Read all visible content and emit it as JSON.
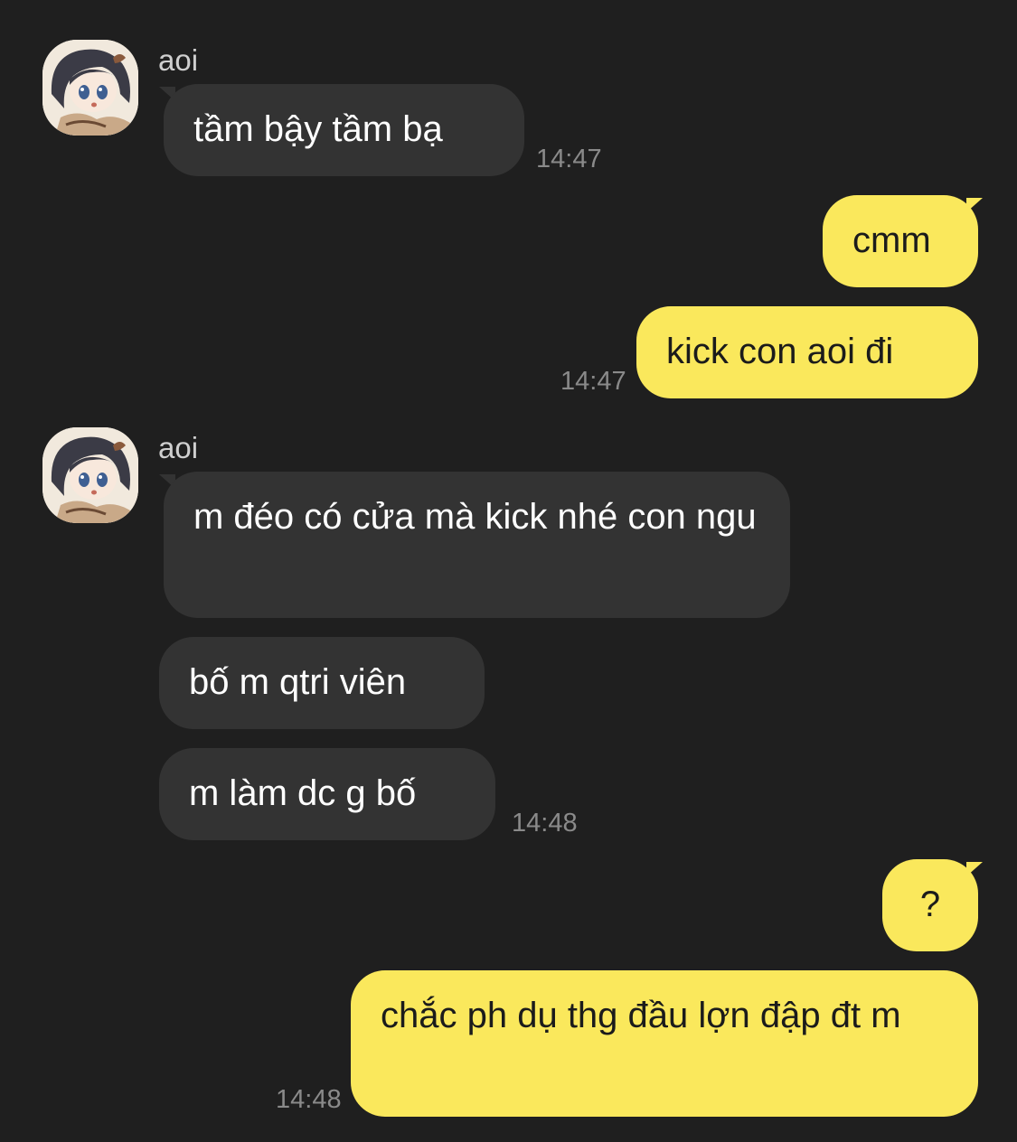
{
  "messages": [
    {
      "sender": "aoi",
      "text": "tầm bậy tầm bạ",
      "time": "14:47"
    },
    {
      "sender": "me",
      "text": "cmm"
    },
    {
      "sender": "me",
      "text": "kick con aoi đi",
      "time": "14:47"
    },
    {
      "sender": "aoi",
      "text": "m đéo có cửa mà kick nhé con ngu"
    },
    {
      "sender": "aoi",
      "text": "bố m qtri viên"
    },
    {
      "sender": "aoi",
      "text": "m làm dc g bố",
      "time": "14:48"
    },
    {
      "sender": "me",
      "text": "?"
    },
    {
      "sender": "me",
      "text": "chắc ph dụ thg đầu lợn đập đt m",
      "time": "14:48"
    }
  ],
  "colors": {
    "background": "#1f1f1f",
    "incoming_bubble": "#333333",
    "outgoing_bubble": "#fae85c",
    "timestamp": "#8a8a8a"
  },
  "icons": {
    "avatar": "anime-girl-avatar"
  }
}
